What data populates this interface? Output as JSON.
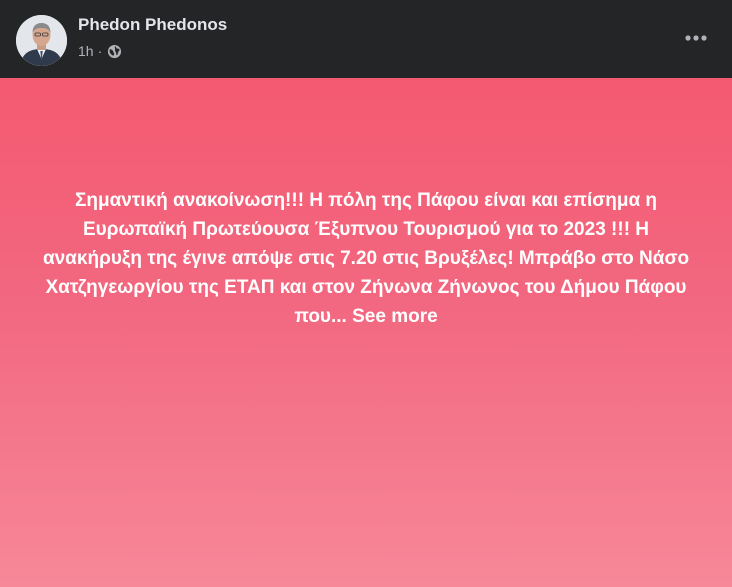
{
  "post": {
    "author_name": "Phedon Phedonos",
    "time": "1h",
    "separator": "·",
    "audience_icon": "globe-icon",
    "more_icon": "more-options-icon",
    "text": "Σημαντική ανακοίνωση!!! Η πόλη της Πάφου είναι και επίσημα η Ευρωπαϊκή Πρωτεύουσα Έξυπνου Τουρισμού για το 2023 !!! Η ανακήρυξη της έγινε απόψε στις 7.20 στις Βρυξέλες! Μπράβο στο Νάσο Χατζηγεωργίου της ΕΤΑΠ και στον Ζήνωνα Ζήνωνος του Δήμου Πάφου που...",
    "see_more_label": "See more"
  },
  "colors": {
    "background_top": "#f45a71",
    "background_bottom": "#f78898",
    "header_bg": "#242526",
    "name_color": "#e4e6eb",
    "meta_color": "#b0b3b8"
  }
}
